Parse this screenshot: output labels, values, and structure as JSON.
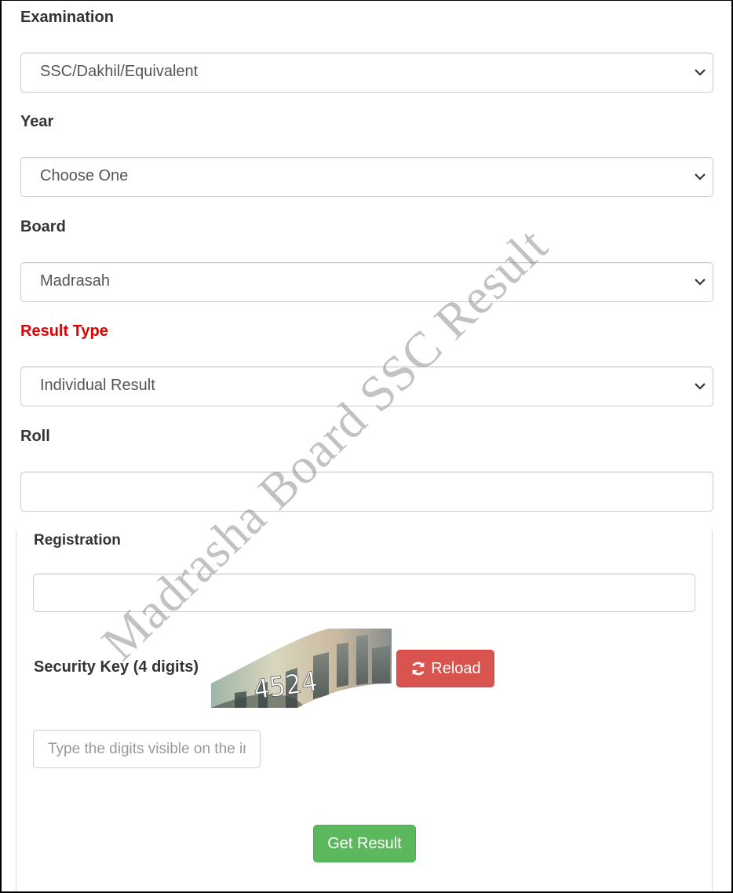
{
  "form": {
    "examination": {
      "label": "Examination",
      "selected": "SSC/Dakhil/Equivalent"
    },
    "year": {
      "label": "Year",
      "selected": "Choose One"
    },
    "board": {
      "label": "Board",
      "selected": "Madrasah"
    },
    "result_type": {
      "label": "Result Type",
      "selected": "Individual Result",
      "label_color": "#e00000"
    },
    "roll": {
      "label": "Roll",
      "value": ""
    },
    "registration": {
      "label": "Registration",
      "value": ""
    },
    "security_key": {
      "label": "Security Key (4 digits)",
      "captcha_text": "4524",
      "reload_label": "Reload",
      "input_value": "",
      "input_placeholder": "Type the digits visible on the image"
    },
    "submit_label": "Get Result"
  },
  "colors": {
    "danger": "#d9534f",
    "success": "#5cb85c"
  },
  "watermark": "Madrasha Board SSC Result"
}
